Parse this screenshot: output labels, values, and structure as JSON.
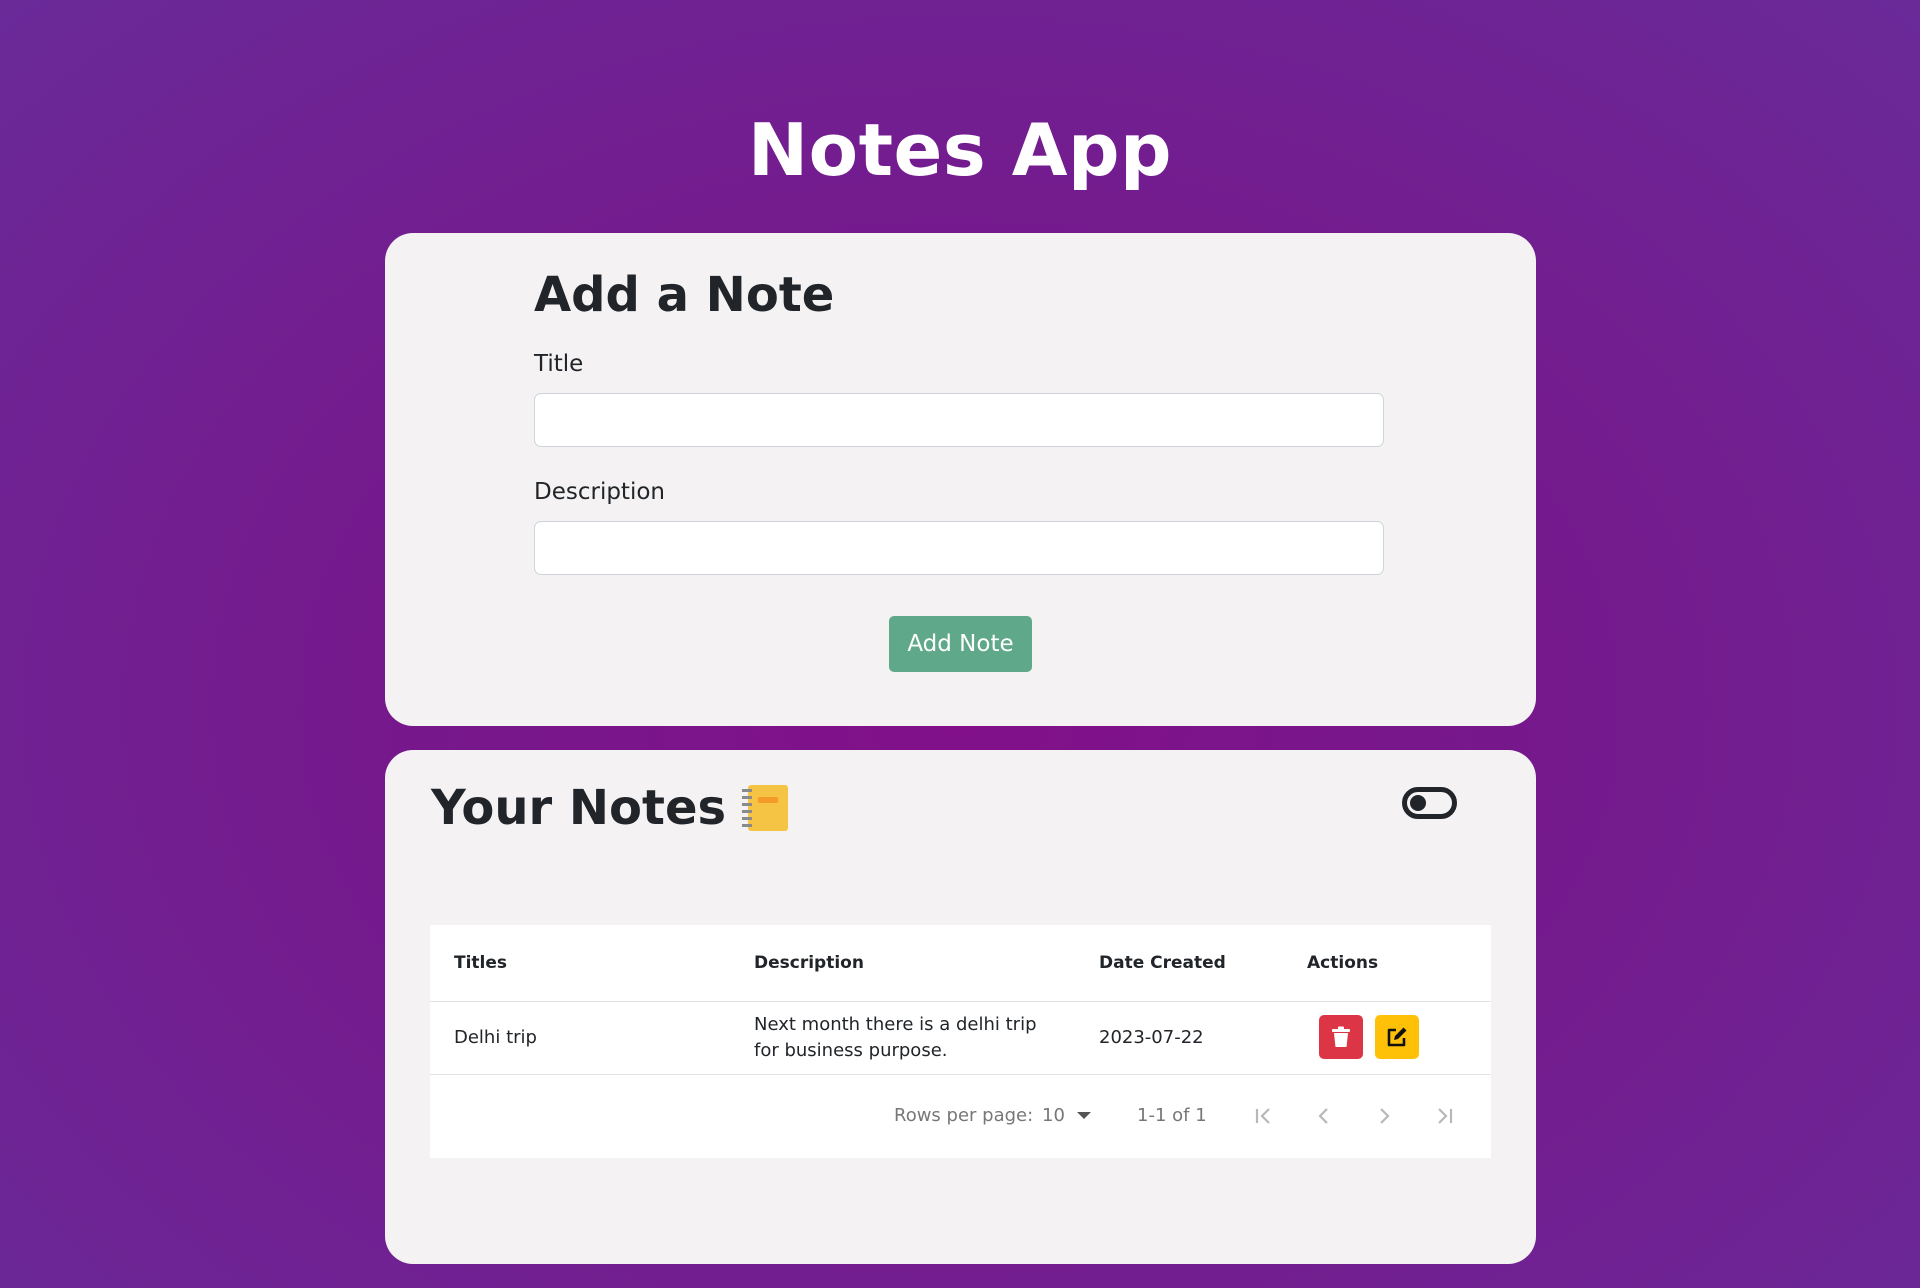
{
  "app": {
    "title": "Notes App"
  },
  "add_note": {
    "heading": "Add a Note",
    "title_label": "Title",
    "title_value": "",
    "description_label": "Description",
    "description_value": "",
    "submit_label": "Add Note"
  },
  "notes": {
    "heading": "Your Notes",
    "heading_icon": "notebook-icon",
    "toggle_icon": "toggle-icon",
    "toggle_state": "off",
    "columns": [
      "Titles",
      "Description",
      "Date Created",
      "Actions"
    ],
    "rows": [
      {
        "title": "Delhi trip",
        "description": "Next month there is a delhi trip for business purpose.",
        "date": "2023-07-22",
        "actions": [
          "trash-icon",
          "edit-icon"
        ]
      }
    ],
    "pagination": {
      "rows_per_page_label": "Rows per page:",
      "rows_per_page": "10",
      "range": "1-1 of 1"
    }
  },
  "colors": {
    "background": "#7a1a8c",
    "card": "#f4f2f3",
    "add_button": "#5fa98a",
    "delete_button": "#dc3545",
    "edit_button": "#ffc107"
  }
}
